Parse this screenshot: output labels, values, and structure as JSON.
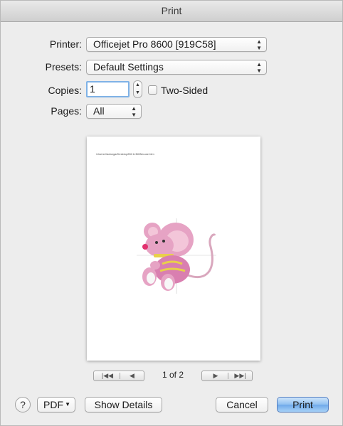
{
  "window": {
    "title": "Print"
  },
  "form": {
    "printer_label": "Printer:",
    "printer_value": "Officejet Pro 8600 [919C58]",
    "presets_label": "Presets:",
    "presets_value": "Default Settings",
    "copies_label": "Copies:",
    "copies_value": "1",
    "two_sided_label": "Two-Sided",
    "two_sided_checked": false,
    "pages_label": "Pages:",
    "pages_value": "All"
  },
  "preview": {
    "path_text": "/Users/Vadanga/Desktop/Bill & Bill/Mouse.htm",
    "image_icon": "mouse-clipart",
    "page_indicator": "1 of 2"
  },
  "nav": {
    "first_icon": "first-page-icon",
    "prev_icon": "previous-page-icon",
    "next_icon": "next-page-icon",
    "last_icon": "last-page-icon"
  },
  "footer": {
    "help_label": "?",
    "pdf_label": "PDF",
    "show_details_label": "Show Details",
    "cancel_label": "Cancel",
    "print_label": "Print"
  },
  "colors": {
    "primary_button": "#8ebff1",
    "focus_ring": "#7fb2e6",
    "mouse_pink": "#d98fb0",
    "mouse_body": "#e79bc0"
  }
}
